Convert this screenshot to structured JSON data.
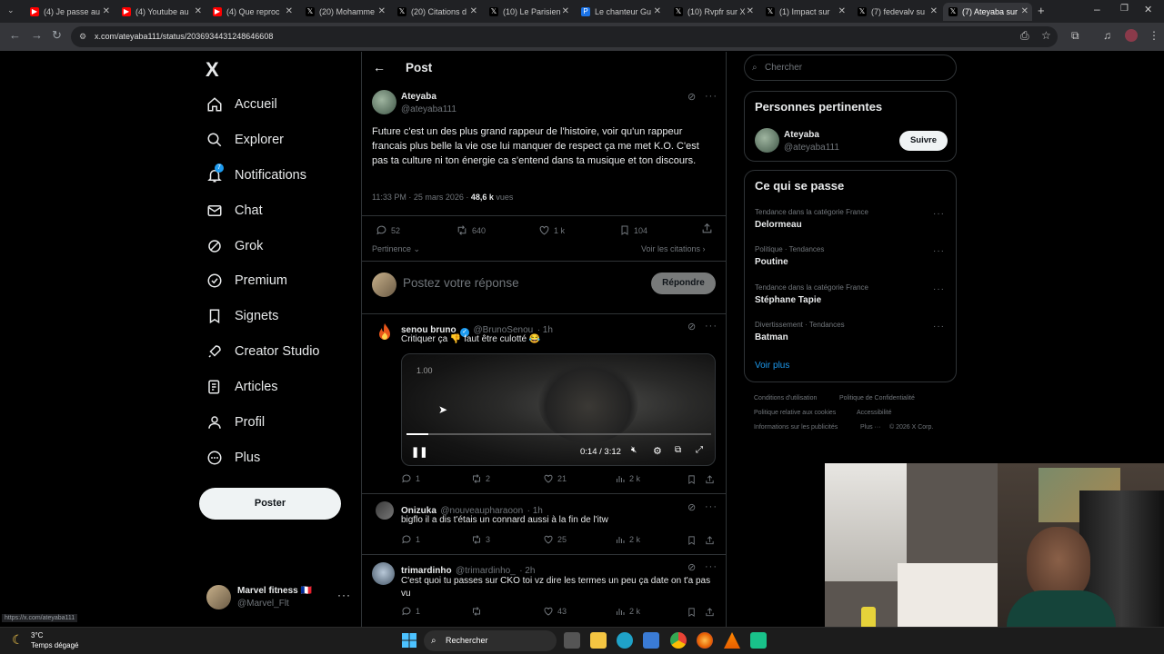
{
  "browser": {
    "tabs": [
      {
        "label": "(4) Je passe au",
        "icon": "youtube-icon",
        "color": "#ff0000"
      },
      {
        "label": "(4) Youtube au",
        "icon": "youtube-icon",
        "color": "#ff0000"
      },
      {
        "label": "(4) Que reproc",
        "icon": "youtube-icon",
        "color": "#ff0000"
      },
      {
        "label": "(20) Mohamme",
        "icon": "x-icon",
        "color": "#000000"
      },
      {
        "label": "(20) Citations d",
        "icon": "x-icon",
        "color": "#000000"
      },
      {
        "label": "(10) Le Parisien",
        "icon": "x-icon",
        "color": "#000000"
      },
      {
        "label": "Le chanteur Gu",
        "icon": "news-icon",
        "color": "#1a73e8"
      },
      {
        "label": "(10) Rvpfr sur X",
        "icon": "x-icon",
        "color": "#000000"
      },
      {
        "label": "(1) Impact sur",
        "icon": "x-icon",
        "color": "#000000"
      },
      {
        "label": "(7) fedevalv su",
        "icon": "x-icon",
        "color": "#000000"
      },
      {
        "label": "(7) Ateyaba sur",
        "icon": "x-icon",
        "color": "#000000",
        "active": true
      }
    ],
    "url": "x.com/ateyaba111/status/2036934431248646608",
    "status_url": "https://x.com/ateyaba111"
  },
  "sidebar": {
    "logo": "X",
    "items": [
      {
        "label": "Accueil",
        "icon": "home-icon"
      },
      {
        "label": "Explorer",
        "icon": "search-icon"
      },
      {
        "label": "Notifications",
        "icon": "bell-icon",
        "badge": "7"
      },
      {
        "label": "Chat",
        "icon": "mail-icon"
      },
      {
        "label": "Grok",
        "icon": "grok-icon"
      },
      {
        "label": "Premium",
        "icon": "verified-icon"
      },
      {
        "label": "Signets",
        "icon": "bookmark-icon"
      },
      {
        "label": "Creator Studio",
        "icon": "rocket-icon"
      },
      {
        "label": "Articles",
        "icon": "article-icon"
      },
      {
        "label": "Profil",
        "icon": "person-icon"
      },
      {
        "label": "Plus",
        "icon": "more-circle-icon"
      }
    ],
    "post_button": "Poster",
    "account": {
      "name": "Marvel fitness 🇫🇷",
      "handle": "@Marvel_Flt"
    }
  },
  "main": {
    "header": "Post",
    "post": {
      "author": "Ateyaba",
      "handle": "@ateyaba111",
      "text": "Future c'est un des plus grand rappeur de l'histoire, voir qu'un rappeur francais plus belle la vie ose lui manquer de respect ça me met K.O. C'est pas ta culture ni ton énergie ca s'entend dans ta musique et ton discours.",
      "time": "11:33 PM · 25 mars 2026 · ",
      "views": "48,6 k",
      "views_label": " vues",
      "replies": "52",
      "reposts": "640",
      "likes": "1 k",
      "bookmarks": "104",
      "sort": "Pertinence",
      "quotes_link": "Voir les citations"
    },
    "composer": {
      "placeholder": "Postez votre réponse",
      "button": "Répondre"
    },
    "replies": [
      {
        "name": "senou bruno",
        "handle": "@BrunoSenou",
        "time": "· 1h",
        "text": "Critiquer ça 👎 faut être culotté 😂",
        "replies": "1",
        "reposts": "2",
        "likes": "21",
        "views": "2 k",
        "verified": true,
        "video": {
          "speed": "1.00",
          "time": "0:14 / 3:12",
          "progress": 0.073
        }
      },
      {
        "name": "Onizuka",
        "handle": "@nouveaupharaoon",
        "time": "· 1h",
        "text": "bigflo il a dis t'étais un connard aussi à la fin de l'itw",
        "replies": "1",
        "reposts": "3",
        "likes": "25",
        "views": "2 k"
      },
      {
        "name": "trimardinho",
        "handle": "@trimardinho_",
        "time": "· 2h",
        "text": "C'est quoi tu passes sur CKO toi vz dire les termes un peu ça date on t'a pas vu",
        "replies": "1",
        "reposts": "",
        "likes": "43",
        "views": "2 k"
      }
    ]
  },
  "right": {
    "search_placeholder": "Chercher",
    "relevant_title": "Personnes pertinentes",
    "relevant": {
      "name": "Ateyaba",
      "handle": "@ateyaba111",
      "follow": "Suivre"
    },
    "trends_title": "Ce qui se passe",
    "trends": [
      {
        "category": "Tendance dans la catégorie France",
        "name": "Delormeau"
      },
      {
        "category": "Politique · Tendances",
        "name": "Poutine"
      },
      {
        "category": "Tendance dans la catégorie France",
        "name": "Stéphane Tapie"
      },
      {
        "category": "Divertissement · Tendances",
        "name": "Batman"
      }
    ],
    "show_more": "Voir plus",
    "footer": [
      "Conditions d'utilisation",
      "Politique de Confidentialité",
      "Politique relative aux cookies",
      "Accessibilité",
      "Informations sur les publicités",
      "Plus ···",
      "© 2026 X Corp."
    ]
  },
  "taskbar": {
    "weather_temp": "3°C",
    "weather_text": "Temps dégagé",
    "search": "Rechercher"
  },
  "colors": {
    "accent": "#1d9bf0",
    "background": "#000000",
    "border": "#2f3336",
    "muted": "#71767b"
  }
}
